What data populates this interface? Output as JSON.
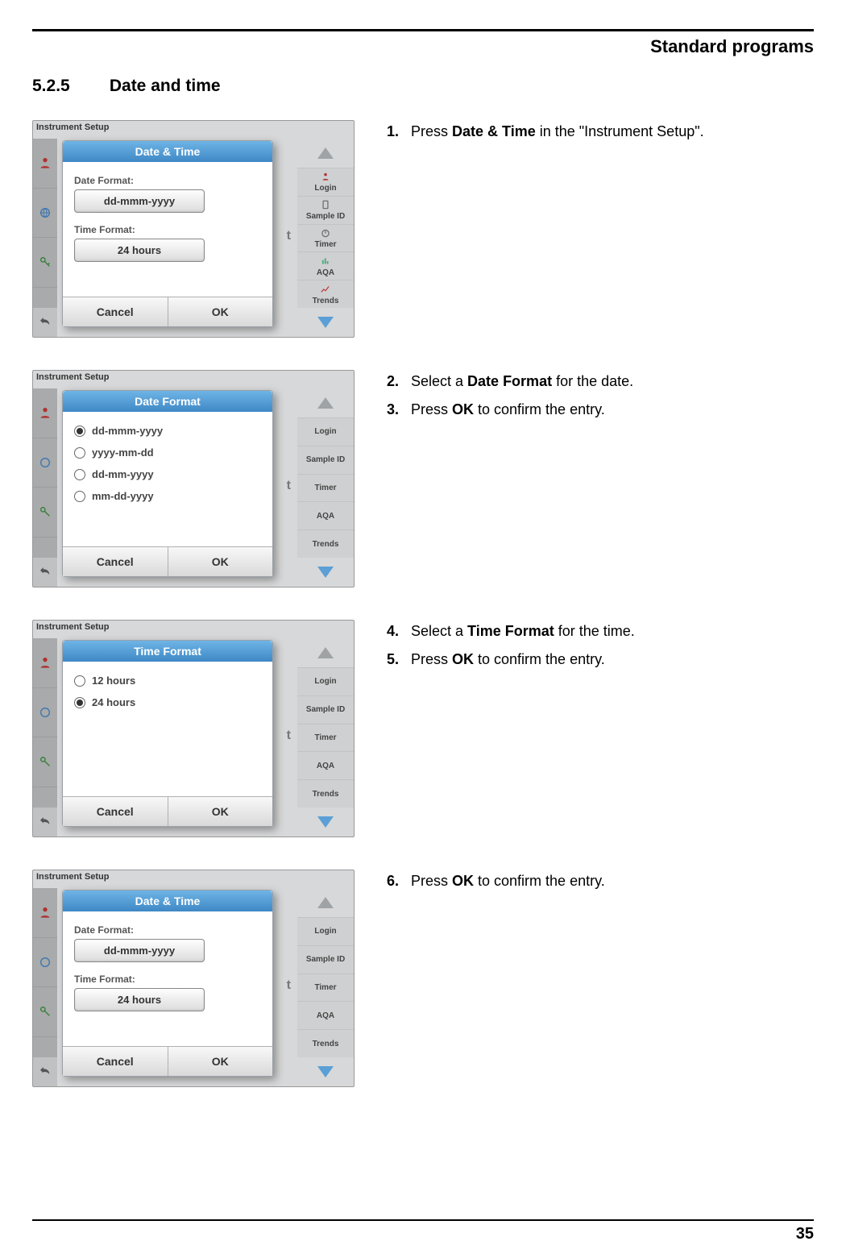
{
  "header": {
    "running": "Standard programs"
  },
  "section": {
    "number": "5.2.5",
    "title": "Date and time"
  },
  "page_number": "35",
  "sidebar": {
    "labels": [
      "Login",
      "Sample ID",
      "Timer",
      "AQA",
      "Trends"
    ]
  },
  "buttons": {
    "cancel": "Cancel",
    "ok": "OK"
  },
  "shots": {
    "s1": {
      "win_title": "Instrument Setup",
      "dialog_title": "Date & Time",
      "date_label": "Date Format:",
      "date_value": "dd-mmm-yyyy",
      "time_label": "Time Format:",
      "time_value": "24 hours"
    },
    "s2": {
      "win_title": "Instrument Setup",
      "dialog_title": "Date Format",
      "opts": [
        "dd-mmm-yyyy",
        "yyyy-mm-dd",
        "dd-mm-yyyy",
        "mm-dd-yyyy"
      ]
    },
    "s3": {
      "win_title": "Instrument Setup",
      "dialog_title": "Time Format",
      "opts": [
        "12 hours",
        "24 hours"
      ]
    },
    "s4": {
      "win_title": "Instrument Setup",
      "dialog_title": "Date & Time",
      "date_label": "Date Format:",
      "date_value": "dd-mmm-yyyy",
      "time_label": "Time Format:",
      "time_value": "24 hours"
    }
  },
  "steps": {
    "r1": [
      {
        "n": "1.",
        "pre": "Press ",
        "bold": "Date & Time",
        "post": " in the \"Instrument Setup\"."
      }
    ],
    "r2": [
      {
        "n": "2.",
        "pre": "Select a ",
        "bold": "Date Format",
        "post": " for the date."
      },
      {
        "n": "3.",
        "pre": "Press ",
        "bold": "OK",
        "post": " to confirm the entry."
      }
    ],
    "r3": [
      {
        "n": "4.",
        "pre": "Select a ",
        "bold": "Time Format",
        "post": " for the time."
      },
      {
        "n": "5.",
        "pre": "Press ",
        "bold": "OK",
        "post": " to confirm the entry."
      }
    ],
    "r4": [
      {
        "n": "6.",
        "pre": "Press ",
        "bold": "OK",
        "post": " to confirm the entry."
      }
    ]
  }
}
